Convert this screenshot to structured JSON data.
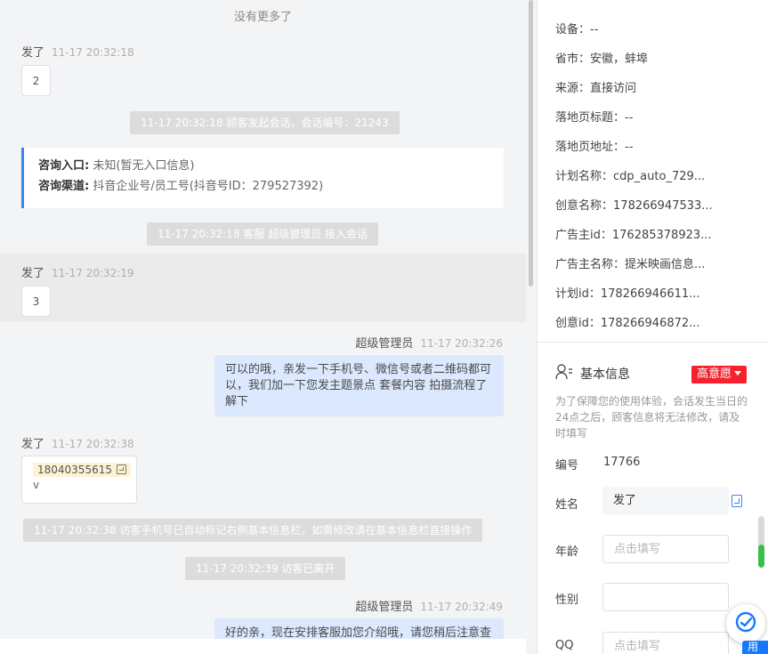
{
  "chat": {
    "no_more": "没有更多了",
    "messages": [
      {
        "name": "发了",
        "time": "11-17 20:32:18",
        "content": "2"
      },
      {
        "system": "11-17 20:32:18 顾客发起会话，会话编号：21243"
      },
      {
        "consult": {
          "entry_label": "咨询入口:",
          "entry_value": "未知(暂无入口信息)",
          "channel_label": "咨询渠道:",
          "channel_value": "抖音企业号/员工号(抖音号ID：279527392)"
        }
      },
      {
        "system": "11-17 20:32:18 客服 超级管理员 接入会话"
      },
      {
        "name": "发了",
        "time": "11-17 20:32:19",
        "content": "3"
      },
      {
        "name": "超级管理员",
        "time": "11-17 20:32:26",
        "content": "可以的哦，亲发一下手机号、微信号或者二维码都可以，我们加一下您发主题景点 套餐内容 拍摄流程了解下"
      },
      {
        "name": "发了",
        "time": "11-17 20:32:38",
        "phone": "18040355615",
        "extra": "v"
      },
      {
        "system": "11-17 20:32:38 访客手机号已自动标记右侧基本信息栏，如需修改请在基本信息栏直接操作"
      },
      {
        "system": "11-17 20:32:39 访客已离开"
      },
      {
        "name": "超级管理员",
        "time": "11-17 20:32:49",
        "content": "好的亲，现在安排客服加您介绍哦，请您稍后注意查"
      }
    ]
  },
  "panel": {
    "attributes": [
      {
        "label": "设备",
        "value": "--"
      },
      {
        "label": "省市",
        "value": "安徽，蚌埠"
      },
      {
        "label": "来源",
        "value": "直接访问"
      },
      {
        "label": "落地页标题",
        "value": "--"
      },
      {
        "label": "落地页地址",
        "value": "--"
      },
      {
        "label": "计划名称",
        "value": "cdp_auto_729..."
      },
      {
        "label": "创意名称",
        "value": "178266947533..."
      },
      {
        "label": "广告主id",
        "value": "176285378923..."
      },
      {
        "label": "广告主名称",
        "value": "提米映画信息..."
      },
      {
        "label": "计划id",
        "value": "178266946611..."
      },
      {
        "label": "创意id",
        "value": "178266946872..."
      }
    ],
    "basic": {
      "title": "基本信息",
      "intent": "高意愿",
      "notice": "为了保障您的使用体验，会话发生当日的24点之后，顾客信息将无法修改，请及时填写",
      "number_label": "编号",
      "number_value": "17766",
      "name_label": "姓名",
      "name_value": "发了",
      "age_label": "年龄",
      "age_placeholder": "点击填写",
      "gender_label": "性别",
      "gender_value": "",
      "qq_label": "QQ",
      "qq_placeholder": "点击填写"
    },
    "use_button": "用"
  },
  "colors": {
    "accent": "#3b82f6",
    "intent_red": "#f5222d",
    "outgoing_bubble": "#dbe8fd",
    "system_gray": "#dcdcdc"
  }
}
